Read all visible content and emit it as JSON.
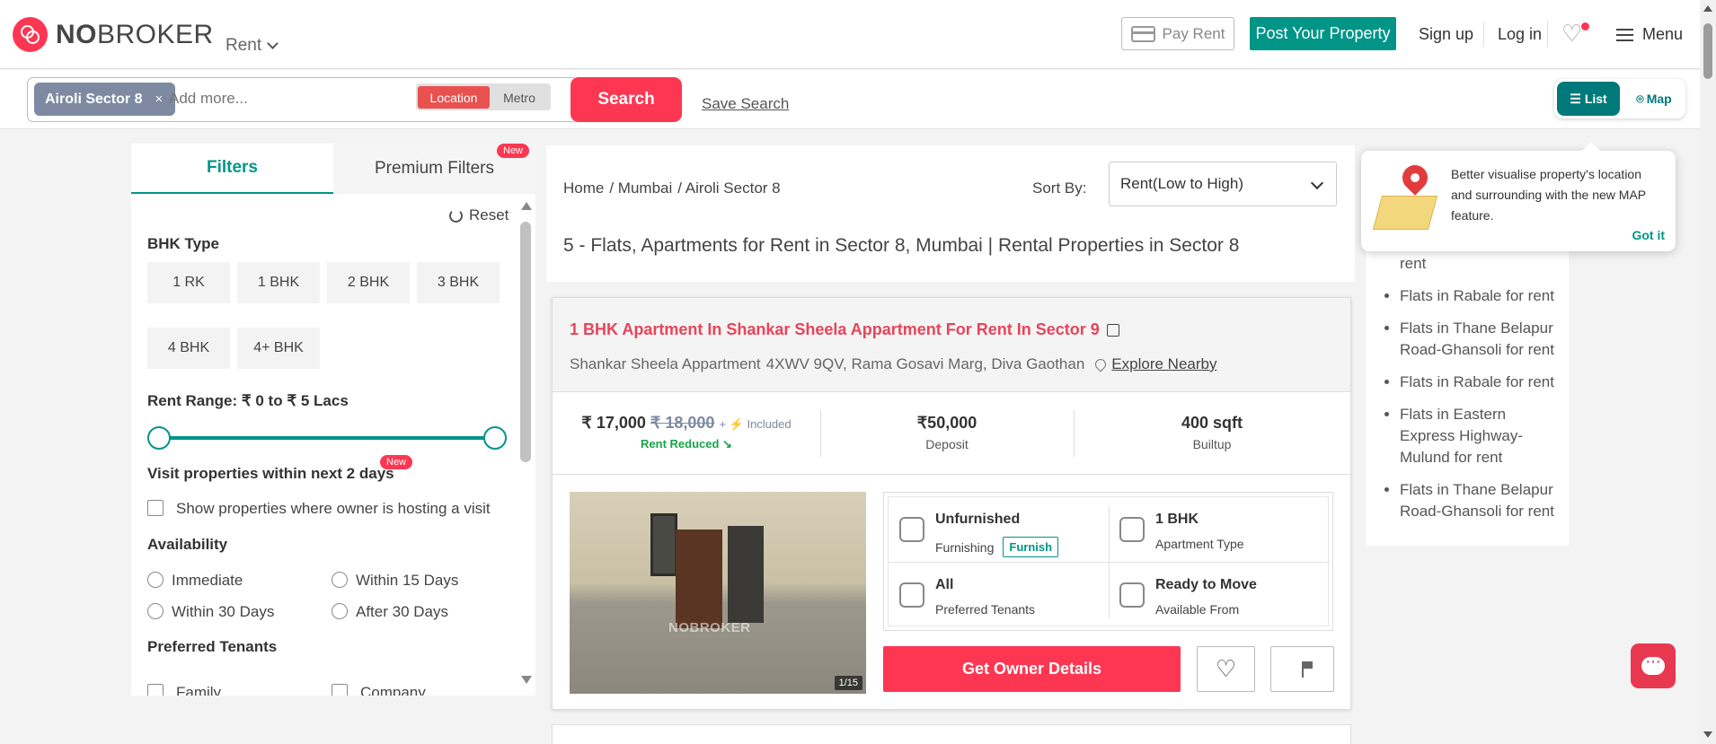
{
  "header": {
    "logo_text_bold": "NO",
    "logo_text_rest": "BROKER",
    "rent_dropdown": "Rent",
    "pay_rent": "Pay Rent",
    "post_property": "Post Your Property",
    "sign_up": "Sign up",
    "log_in": "Log in",
    "menu": "Menu"
  },
  "search": {
    "chip_label": "Airoli Sector 8",
    "chip_close": "×",
    "placeholder": "Add more...",
    "location_label": "Location",
    "metro_label": "Metro",
    "search_button": "Search",
    "save_search": "Save Search"
  },
  "view_toggle": {
    "list": "List",
    "map": "Map"
  },
  "filters": {
    "tab_filters": "Filters",
    "tab_premium": "Premium Filters",
    "premium_badge": "New",
    "reset": "Reset",
    "bhk_title": "BHK Type",
    "bhk_options": [
      "1 RK",
      "1 BHK",
      "2 BHK",
      "3 BHK",
      "4 BHK",
      "4+ BHK"
    ],
    "rent_range": "Rent Range: ₹ 0 to ₹ 5 Lacs",
    "rent_range_min_fraction": 0,
    "rent_range_max_fraction": 1,
    "visit_title": "Visit properties within next 2 days",
    "visit_badge": "New",
    "visit_checkbox": "Show properties where owner is hosting a visit",
    "availability_title": "Availability",
    "availability_options": [
      "Immediate",
      "Within 15 Days",
      "Within 30 Days",
      "After 30 Days"
    ],
    "tenants_title": "Preferred Tenants",
    "tenant_options": [
      "Family",
      "Company"
    ]
  },
  "results": {
    "breadcrumb": [
      "Home",
      "/ Mumbai",
      "/ Airoli Sector 8"
    ],
    "sort_label": "Sort By:",
    "sort_value": "Rent(Low to High)",
    "title": "5 - Flats, Apartments for Rent in Sector 8, Mumbai | Rental Properties in Sector 8"
  },
  "listing": {
    "title": "1 BHK Apartment In Shankar Sheela Appartment For Rent In Sector 9",
    "address_society": "Shankar Sheela Appartment",
    "address": "4XWV 9QV, Rama Gosavi Marg, Diva Gaothan",
    "explore": "Explore Nearby",
    "price": "₹ 17,000",
    "old_price": "₹ 18,000",
    "included": "+ ⚡ Included",
    "rent_reduced": "Rent Reduced ↘",
    "deposit": "₹50,000",
    "deposit_label": "Deposit",
    "area": "400 sqft",
    "area_label": "Builtup",
    "photo_watermark": "NOBROKER",
    "photo_count": "1/15",
    "furnishing": "Unfurnished",
    "furnishing_label": "Furnishing",
    "furnish_tag": "Furnish",
    "apartment_type": "1 BHK",
    "apartment_type_label": "Apartment Type",
    "tenants": "All",
    "tenants_label": "Preferred Tenants",
    "availability": "Ready to Move",
    "availability_label": "Available From",
    "owner_button": "Get Owner Details"
  },
  "tooltip": {
    "text": "Better visualise property's location and surrounding with the new MAP feature.",
    "got_it": "Got it"
  },
  "side_links": [
    "Flats in Ghansoli for rent",
    "Flats in Rabale for rent",
    "Flats in Thane Belapur Road-Ghansoli for rent",
    "Flats in Rabale for rent",
    "Flats in Eastern Express Highway-Mulund for rent",
    "Flats in Thane Belapur Road-Ghansoli for rent"
  ],
  "colors": {
    "brand_red": "#fd3752",
    "brand_teal": "#009587",
    "chip_grey": "#7e8aa2"
  }
}
